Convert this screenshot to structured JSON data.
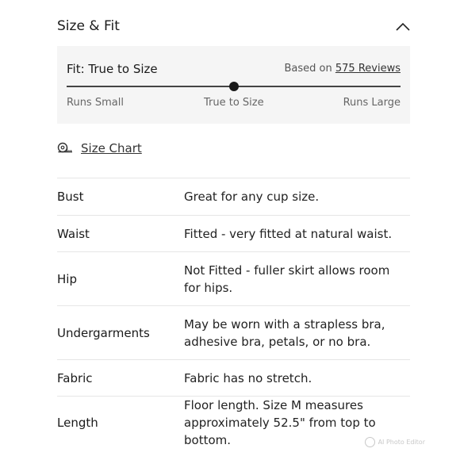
{
  "header": {
    "title": "Size & Fit"
  },
  "fit": {
    "title": "Fit: True to Size",
    "reviews_prefix": "Based on",
    "reviews_link": "575 Reviews",
    "scale_left": "Runs Small",
    "scale_mid": "True to Size",
    "scale_right": "Runs Large",
    "position": 0.5
  },
  "size_chart": {
    "label": "Size Chart",
    "icon": "measuring-tape-icon"
  },
  "specs": [
    {
      "label": "Bust",
      "value": "Great for any cup size."
    },
    {
      "label": "Waist",
      "value": "Fitted - very fitted at natural waist."
    },
    {
      "label": "Hip",
      "value": "Not Fitted - fuller skirt allows room for hips."
    },
    {
      "label": "Undergarments",
      "value": "May be worn with a strapless bra, adhesive bra, petals, or no bra."
    },
    {
      "label": "Fabric",
      "value": "Fabric has no stretch."
    },
    {
      "label": "Length",
      "value": "Floor length. Size M measures approximately 52.5\" from top to bottom."
    }
  ],
  "watermark": {
    "text": "AI Photo Editor"
  }
}
